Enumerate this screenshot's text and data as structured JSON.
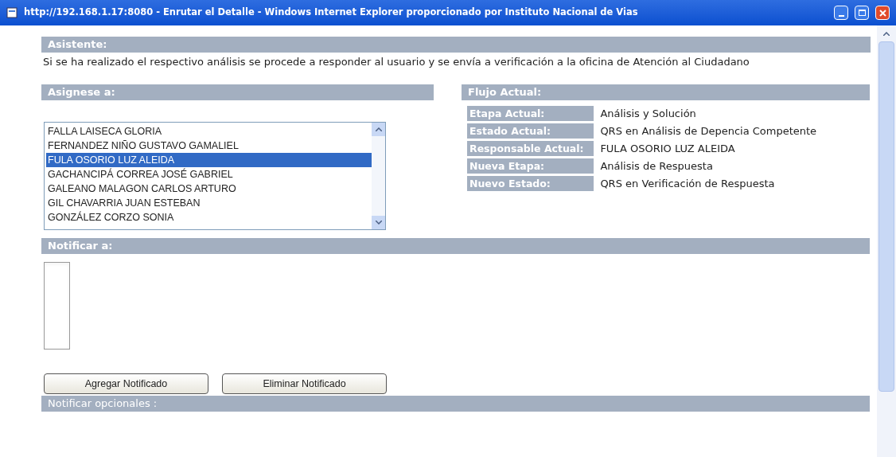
{
  "window": {
    "title": "http://192.168.1.17:8080 - Enrutar el Detalle - Windows Internet Explorer proporcionado por Instituto Nacional de Vias"
  },
  "asistente": {
    "header": "Asistente:",
    "text": "Si se ha realizado el respectivo análisis se procede a responder al usuario y se envía a verificación a la oficina de Atención al Ciudadano"
  },
  "asignese": {
    "header": "Asignese a:",
    "items": [
      {
        "label": "FALLA LAISECA GLORIA",
        "selected": false
      },
      {
        "label": "FERNANDEZ NIÑO GUSTAVO GAMALIEL",
        "selected": false
      },
      {
        "label": "FULA OSORIO LUZ ALEIDA",
        "selected": true
      },
      {
        "label": "GACHANCIPÁ CORREA JOSÉ GABRIEL",
        "selected": false
      },
      {
        "label": "GALEANO MALAGON CARLOS ARTURO",
        "selected": false
      },
      {
        "label": "GIL CHAVARRIA JUAN ESTEBAN",
        "selected": false
      },
      {
        "label": "GONZÁLEZ CORZO SONIA",
        "selected": false
      }
    ]
  },
  "flujo": {
    "header": "Flujo Actual:",
    "rows": [
      {
        "label": "Etapa Actual:",
        "value": "Análisis y Solución"
      },
      {
        "label": "Estado Actual:",
        "value": "QRS en Análisis de Depencia Competente"
      },
      {
        "label": "Responsable Actual:",
        "value": "FULA OSORIO LUZ ALEIDA"
      },
      {
        "label": "Nueva Etapa:",
        "value": "Análisis de Respuesta"
      },
      {
        "label": "Nuevo Estado:",
        "value": "QRS en Verificación de Respuesta"
      }
    ]
  },
  "notificar": {
    "header": "Notificar a:",
    "buttons": [
      "Agregar Notificado",
      "Eliminar Notificado"
    ]
  },
  "opcionales": {
    "header": "Notificar opcionales :"
  }
}
